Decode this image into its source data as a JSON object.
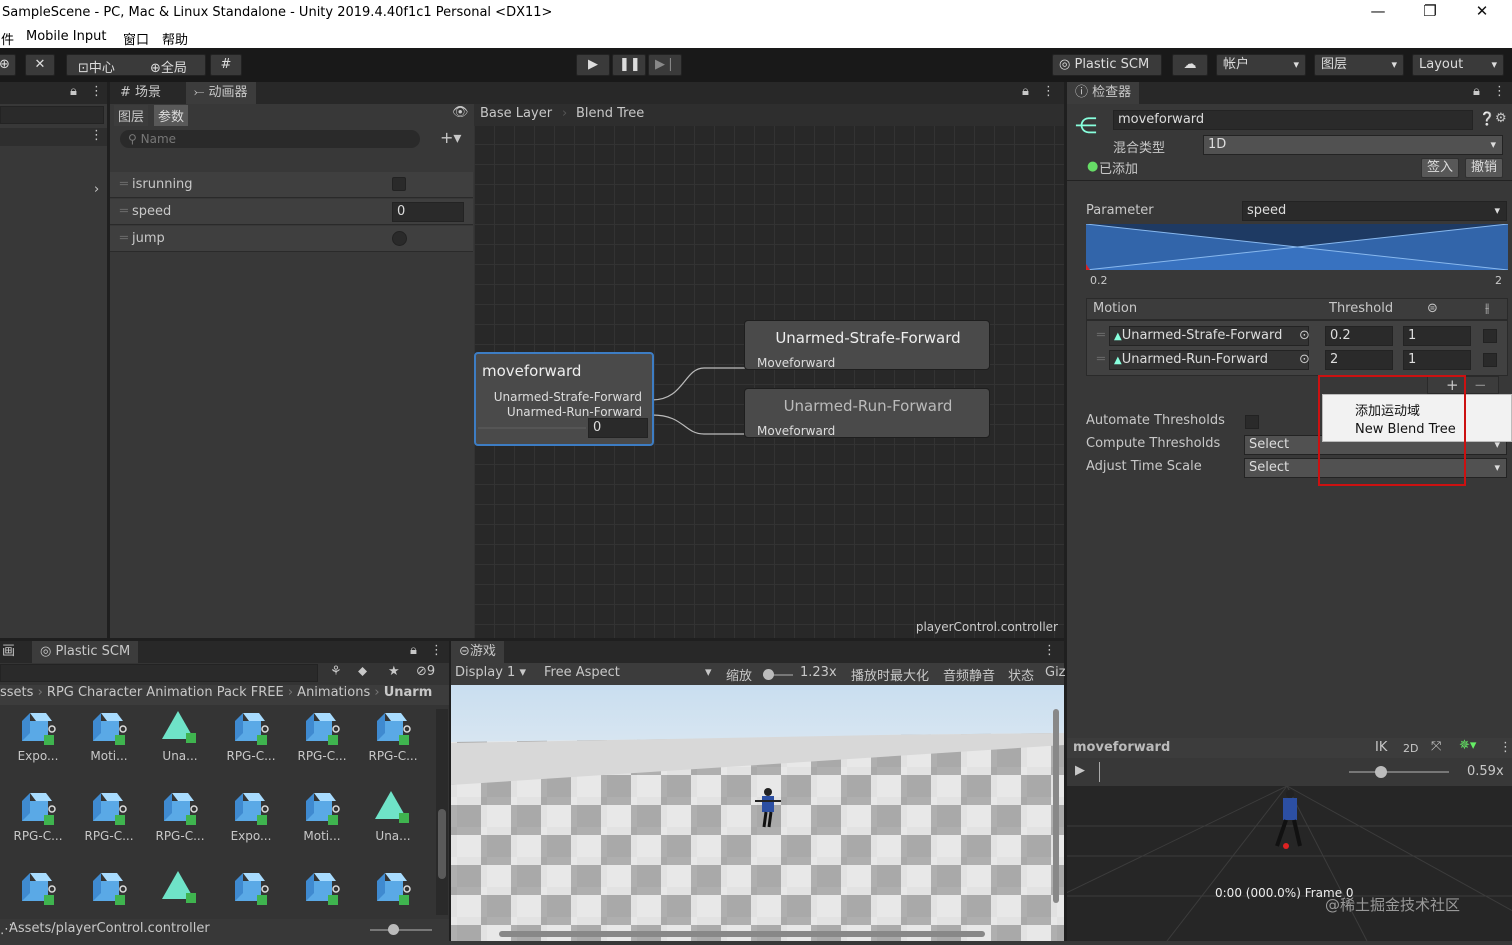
{
  "window": {
    "title": "SampleScene - PC, Mac & Linux Standalone - Unity 2019.4.40f1c1 Personal <DX11>",
    "minimize": "—",
    "maximize": "❐",
    "close": "✕"
  },
  "menu": [
    "件",
    "Mobile Input",
    "窗口",
    "帮助"
  ],
  "toolbar": {
    "pivot": "中心",
    "global": "全局",
    "plastic": "Plastic SCM",
    "account": "帐户",
    "layers": "图层",
    "layout": "Layout"
  },
  "animator": {
    "tabs": {
      "scene": "场景",
      "animator": "动画器"
    },
    "subtabs": {
      "layers": "图层",
      "params": "参数"
    },
    "search_placeholder": "Name",
    "breadcrumb": [
      "Base Layer",
      "Blend Tree"
    ],
    "params": [
      {
        "name": "isrunning",
        "type": "bool"
      },
      {
        "name": "speed",
        "type": "float",
        "value": "0"
      },
      {
        "name": "jump",
        "type": "trigger"
      }
    ],
    "blend_node": {
      "title": "moveforward",
      "items": [
        "Unarmed-Strafe-Forward",
        "Unarmed-Run-Forward"
      ],
      "value": "0"
    },
    "motion_nodes": [
      {
        "title": "Unarmed-Strafe-Forward",
        "sub": "Moveforward"
      },
      {
        "title": "Unarmed-Run-Forward",
        "sub": "Moveforward"
      }
    ],
    "footer": "playerControl.controller"
  },
  "inspector": {
    "tab": "检查器",
    "name": "moveforward",
    "blend_type_label": "混合类型",
    "blend_type": "1D",
    "added": "已添加",
    "checkin": "签入",
    "undo": "撤销",
    "parameter_label": "Parameter",
    "parameter_value": "speed",
    "range_min": "0.2",
    "range_max": "2",
    "motion_header": "Motion",
    "threshold_header": "Threshold",
    "motions": [
      {
        "name": "Unarmed-Strafe-Forward",
        "threshold": "0.2",
        "speed": "1"
      },
      {
        "name": "Unarmed-Run-Forward",
        "threshold": "2",
        "speed": "1"
      }
    ],
    "popup": [
      "添加运动域",
      "New Blend Tree"
    ],
    "automate": "Automate Thresholds",
    "compute": "Compute Thresholds",
    "compute_value": "Select",
    "adjust": "Adjust Time Scale",
    "adjust_value": "Select",
    "preview_title": "moveforward",
    "preview_ik": "IK",
    "preview_2d": "2D",
    "preview_speed": "0.59x",
    "preview_frame": "0:00 (000.0%) Frame 0",
    "watermark": "@稀土掘金技术社区"
  },
  "project": {
    "tab_left": "画",
    "tab": "Plastic SCM",
    "hidden_count": "9",
    "breadcrumb": [
      "ssets",
      "RPG Character Animation Pack FREE",
      "Animations",
      "Unarm"
    ],
    "assets_row1": [
      "Expo...",
      "Moti...",
      "Una...",
      "RPG-C...",
      "RPG-C...",
      "RPG-C..."
    ],
    "assets_row2": [
      "RPG-C...",
      "RPG-C...",
      "RPG-C...",
      "Expo...",
      "Moti...",
      "Una..."
    ],
    "footer": "Assets/playerControl.controller"
  },
  "game": {
    "tab": "游戏",
    "display": "Display 1",
    "aspect": "Free Aspect",
    "scale_label": "缩放",
    "scale": "1.23x",
    "maximize": "播放时最大化",
    "mute": "音频静音",
    "stats": "状态",
    "gizmos": "Giz"
  },
  "colors": {
    "accent": "#3d7dc4",
    "highlight": "#cc1111",
    "sky": "#cfe3f2"
  }
}
